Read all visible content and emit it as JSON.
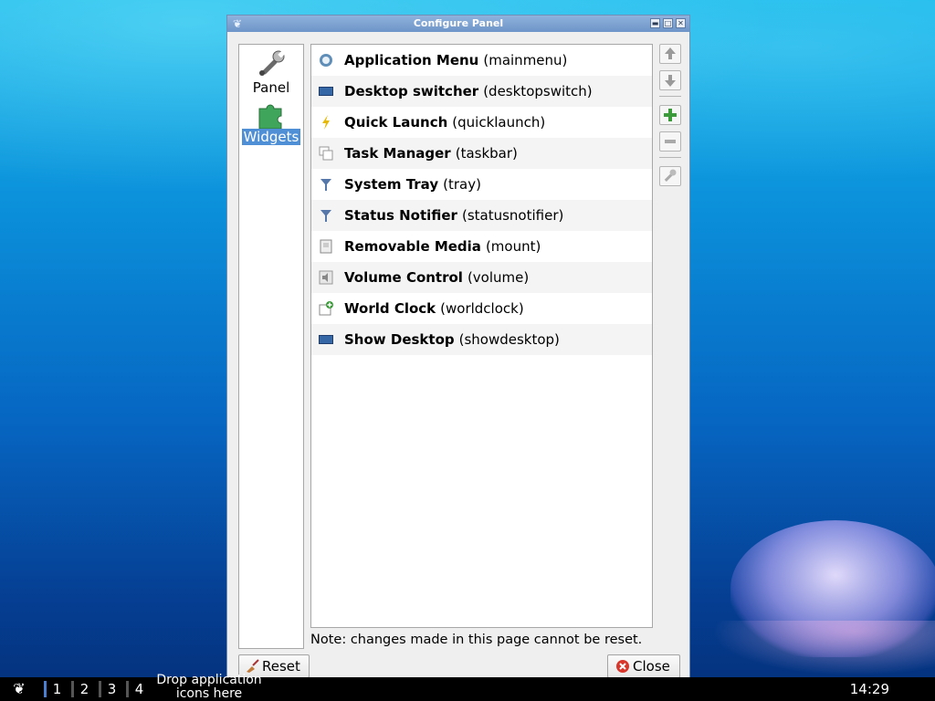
{
  "window": {
    "title": "Configure Panel",
    "controls": {
      "minimize": "▬",
      "maximize": "□",
      "close": "✕"
    }
  },
  "sidebar": {
    "items": [
      {
        "label": "Panel",
        "icon": "wrench-icon",
        "selected": false
      },
      {
        "label": "Widgets",
        "icon": "puzzle-icon",
        "selected": true
      }
    ]
  },
  "widgets": [
    {
      "name": "Application Menu",
      "id": "(mainmenu)",
      "icon": "app-menu-icon"
    },
    {
      "name": "Desktop switcher",
      "id": "(desktopswitch)",
      "icon": "monitor-icon"
    },
    {
      "name": "Quick Launch",
      "id": "(quicklaunch)",
      "icon": "lightning-icon"
    },
    {
      "name": "Task Manager",
      "id": "(taskbar)",
      "icon": "windows-icon"
    },
    {
      "name": "System Tray",
      "id": "(tray)",
      "icon": "funnel-icon"
    },
    {
      "name": "Status Notifier",
      "id": "(statusnotifier)",
      "icon": "funnel-icon"
    },
    {
      "name": "Removable Media",
      "id": "(mount)",
      "icon": "drive-icon"
    },
    {
      "name": "Volume Control",
      "id": "(volume)",
      "icon": "speaker-icon"
    },
    {
      "name": "World Clock",
      "id": "(worldclock)",
      "icon": "calendar-plus-icon"
    },
    {
      "name": "Show Desktop",
      "id": "(showdesktop)",
      "icon": "monitor-icon"
    }
  ],
  "tools": {
    "move_up": "arrow-up-icon",
    "move_down": "arrow-down-icon",
    "add": "plus-icon",
    "remove": "minus-icon",
    "configure": "wrench-icon"
  },
  "note": "Note: changes made in this page cannot be reset.",
  "buttons": {
    "reset": "Reset",
    "close": "Close"
  },
  "taskbar": {
    "desktops": [
      "1",
      "2",
      "3",
      "4"
    ],
    "quicklaunch_text": "Drop application icons here",
    "clock": "14:29"
  },
  "colors": {
    "selection": "#4f8fd6",
    "titlebar": "#7aa0d0"
  }
}
